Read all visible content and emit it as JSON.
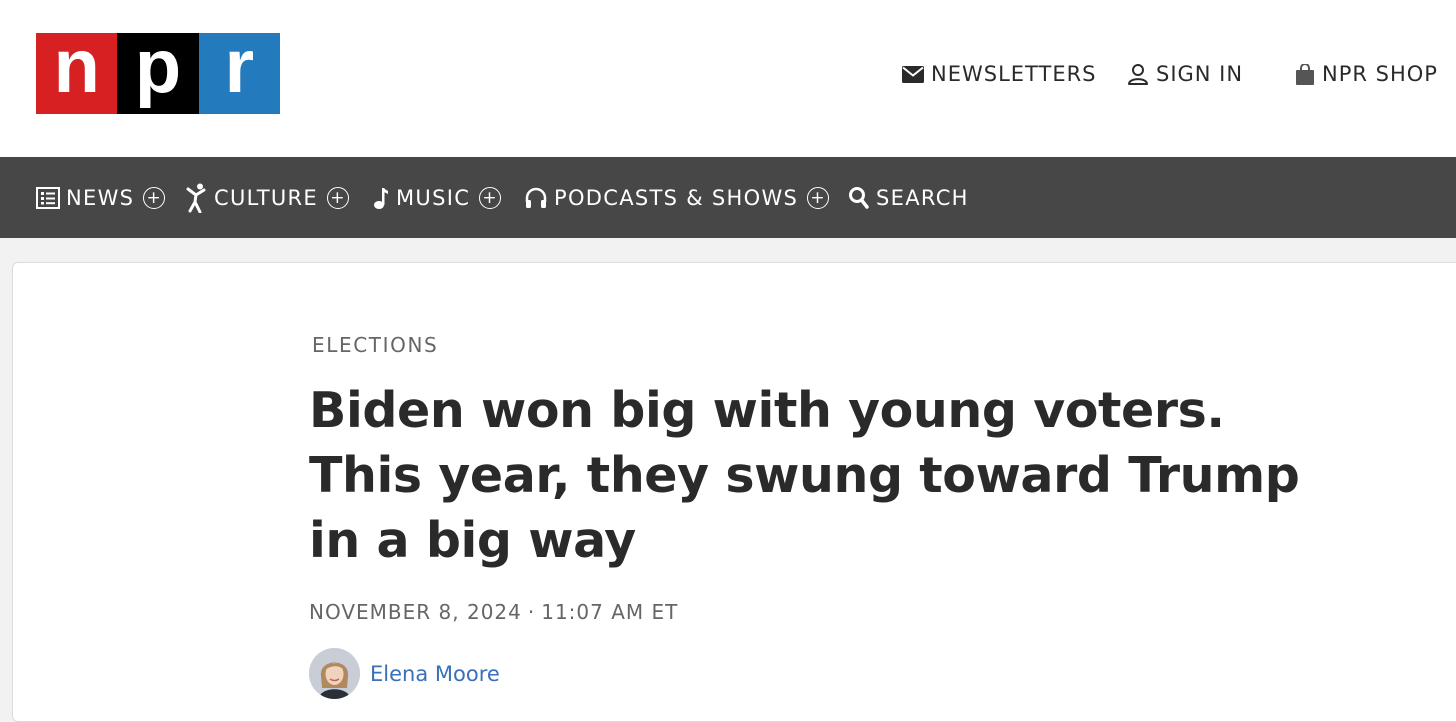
{
  "logo": {
    "letters": [
      "n",
      "p",
      "r"
    ],
    "colors": [
      "#d62021",
      "#000000",
      "#237bbd"
    ]
  },
  "utility": {
    "newsletters": {
      "label": "NEWSLETTERS",
      "icon": "envelope-icon"
    },
    "signin": {
      "label": "SIGN IN",
      "icon": "user-icon"
    },
    "shop": {
      "label": "NPR SHOP",
      "icon": "shopping-bag-icon"
    }
  },
  "nav": {
    "items": [
      {
        "label": "NEWS",
        "icon": "newspaper-icon",
        "expandable": true
      },
      {
        "label": "CULTURE",
        "icon": "dancer-icon",
        "expandable": true
      },
      {
        "label": "MUSIC",
        "icon": "music-note-icon",
        "expandable": true
      },
      {
        "label": "PODCASTS & SHOWS",
        "icon": "headphones-icon",
        "expandable": true
      },
      {
        "label": "SEARCH",
        "icon": "search-icon",
        "expandable": false
      }
    ],
    "expand_glyph": "+",
    "background": "#474747"
  },
  "article": {
    "kicker": "ELECTIONS",
    "headline": "Biden won big with young voters. This year, they swung toward Trump in a big way",
    "date": "NOVEMBER 8, 2024",
    "separator": "·",
    "time": "11:07 AM ET",
    "author": "Elena Moore",
    "author_color": "#3b6fb6"
  }
}
